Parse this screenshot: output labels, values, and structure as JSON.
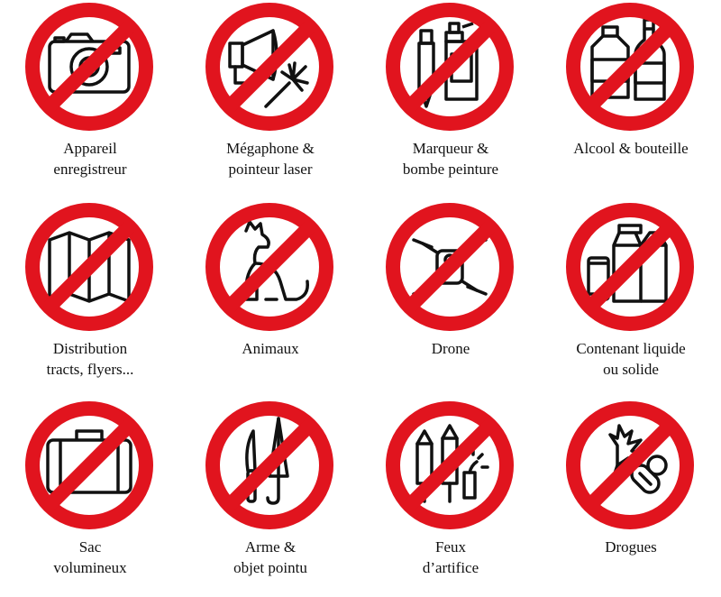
{
  "colors": {
    "prohibition_red": "#e1141e",
    "icon_stroke": "#111111",
    "background": "#ffffff"
  },
  "items": [
    {
      "icon": "camera-icon",
      "lines": [
        "Appareil",
        "enregistreur"
      ]
    },
    {
      "icon": "megaphone-laser-icon",
      "lines": [
        "Mégaphone &",
        "pointeur laser"
      ]
    },
    {
      "icon": "marker-spray-icon",
      "lines": [
        "Marqueur &",
        "bombe peinture"
      ]
    },
    {
      "icon": "bottles-icon",
      "lines": [
        "Alcool & bouteille"
      ]
    },
    {
      "icon": "map-icon",
      "lines": [
        "Distribution",
        "tracts, flyers..."
      ]
    },
    {
      "icon": "dog-icon",
      "lines": [
        "Animaux"
      ]
    },
    {
      "icon": "drone-icon",
      "lines": [
        "Drone"
      ]
    },
    {
      "icon": "containers-icon",
      "lines": [
        "Contenant liquide",
        "ou solide"
      ]
    },
    {
      "icon": "suitcase-icon",
      "lines": [
        "Sac",
        "volumineux"
      ]
    },
    {
      "icon": "knife-umbrella-icon",
      "lines": [
        "Arme &",
        "objet pointu"
      ]
    },
    {
      "icon": "fireworks-icon",
      "lines": [
        "Feux",
        "d’artifice"
      ]
    },
    {
      "icon": "drugs-icon",
      "lines": [
        "Drogues"
      ]
    }
  ]
}
